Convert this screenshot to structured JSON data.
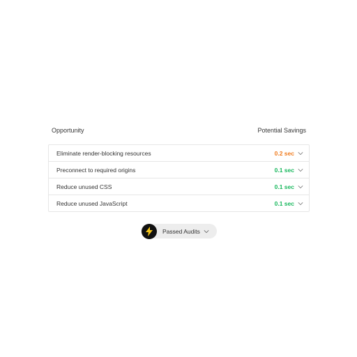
{
  "header": {
    "opportunity_label": "Opportunity",
    "savings_label": "Potential Savings"
  },
  "rows": [
    {
      "label": "Eliminate render-blocking resources",
      "savings": "0.2 sec",
      "color": "#f07b1d"
    },
    {
      "label": "Preconnect to required origins",
      "savings": "0.1 sec",
      "color": "#19b85d"
    },
    {
      "label": "Reduce unused CSS",
      "savings": "0.1 sec",
      "color": "#19b85d"
    },
    {
      "label": "Reduce unused JavaScript",
      "savings": "0.1 sec",
      "color": "#19b85d"
    }
  ],
  "passed": {
    "label": "Passed Audits",
    "icon": "lightning-bolt-icon"
  }
}
